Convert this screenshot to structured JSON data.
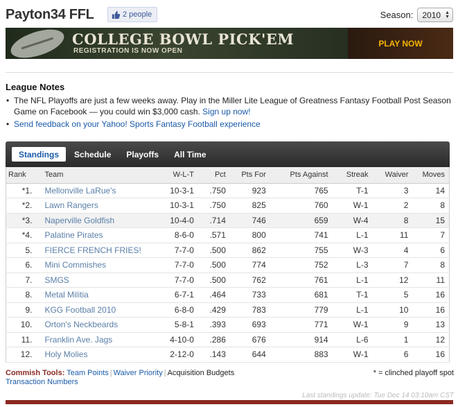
{
  "header": {
    "title": "Payton34 FFL",
    "like_count": "2 people",
    "season_label": "Season:",
    "season_value": "2010"
  },
  "banner": {
    "title": "COLLEGE BOWL PICK'EM",
    "subtitle": "REGISTRATION IS NOW OPEN",
    "cta": "PLAY NOW"
  },
  "notes": {
    "heading": "League Notes",
    "item1_text": "The NFL Playoffs are just a few weeks away. Play in the Miller Lite League of Greatness Fantasy Football Post Season Game on Facebook — you could win $3,000 cash.",
    "item1_link": "Sign up now!",
    "item2_link": "Send feedback on your Yahoo! Sports Fantasy Football experience"
  },
  "tabs": [
    "Standings",
    "Schedule",
    "Playoffs",
    "All Time"
  ],
  "columns": [
    "Rank",
    "Team",
    "W-L-T",
    "Pct",
    "Pts For",
    "Pts Against",
    "Streak",
    "Waiver",
    "Moves"
  ],
  "rows": [
    {
      "rank": "*1.",
      "team": "Mellonville LaRue's",
      "wlt": "10-3-1",
      "pct": ".750",
      "pf": "923",
      "pa": "765",
      "streak": "T-1",
      "waiver": "3",
      "moves": "14"
    },
    {
      "rank": "*2.",
      "team": "Lawn Rangers",
      "wlt": "10-3-1",
      "pct": ".750",
      "pf": "825",
      "pa": "760",
      "streak": "W-1",
      "waiver": "2",
      "moves": "8"
    },
    {
      "rank": "*3.",
      "team": "Naperville Goldfish",
      "wlt": "10-4-0",
      "pct": ".714",
      "pf": "746",
      "pa": "659",
      "streak": "W-4",
      "waiver": "8",
      "moves": "15"
    },
    {
      "rank": "*4.",
      "team": "Palatine Pirates",
      "wlt": "8-6-0",
      "pct": ".571",
      "pf": "800",
      "pa": "741",
      "streak": "L-1",
      "waiver": "11",
      "moves": "7"
    },
    {
      "rank": "5.",
      "team": "FIERCE FRENCH FRIES!",
      "wlt": "7-7-0",
      "pct": ".500",
      "pf": "862",
      "pa": "755",
      "streak": "W-3",
      "waiver": "4",
      "moves": "6"
    },
    {
      "rank": "6.",
      "team": "Mini Commishes",
      "wlt": "7-7-0",
      "pct": ".500",
      "pf": "774",
      "pa": "752",
      "streak": "L-3",
      "waiver": "7",
      "moves": "8"
    },
    {
      "rank": "7.",
      "team": "SMGS",
      "wlt": "7-7-0",
      "pct": ".500",
      "pf": "762",
      "pa": "761",
      "streak": "L-1",
      "waiver": "12",
      "moves": "11"
    },
    {
      "rank": "8.",
      "team": "Metal Militia",
      "wlt": "6-7-1",
      "pct": ".464",
      "pf": "733",
      "pa": "681",
      "streak": "T-1",
      "waiver": "5",
      "moves": "16"
    },
    {
      "rank": "9.",
      "team": "KGG Football 2010",
      "wlt": "6-8-0",
      "pct": ".429",
      "pf": "783",
      "pa": "779",
      "streak": "L-1",
      "waiver": "10",
      "moves": "16"
    },
    {
      "rank": "10.",
      "team": "Orton's Neckbeards",
      "wlt": "5-8-1",
      "pct": ".393",
      "pf": "693",
      "pa": "771",
      "streak": "W-1",
      "waiver": "9",
      "moves": "13"
    },
    {
      "rank": "11.",
      "team": "Franklin Ave. Jags",
      "wlt": "4-10-0",
      "pct": ".286",
      "pf": "676",
      "pa": "914",
      "streak": "L-6",
      "waiver": "1",
      "moves": "12"
    },
    {
      "rank": "12.",
      "team": "Holy Molies",
      "wlt": "2-12-0",
      "pct": ".143",
      "pf": "644",
      "pa": "883",
      "streak": "W-1",
      "waiver": "6",
      "moves": "16"
    }
  ],
  "commish": {
    "label": "Commish Tools:",
    "team_points": "Team Points",
    "waiver_priority": "Waiver Priority",
    "acquisition_budgets": "Acquisition Budgets",
    "transaction_numbers": "Transaction Numbers"
  },
  "footnote": "* = clinched playoff spot",
  "last_update": "Last standings update: Tue Dec 14 03:10am CST",
  "colors": {
    "accent_link": "#1a5aa8",
    "commish_label": "#8a2a22",
    "cta": "#f5b300"
  }
}
